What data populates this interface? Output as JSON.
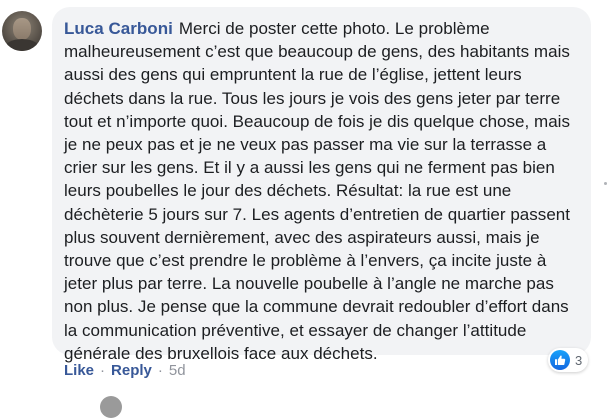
{
  "comment": {
    "author": "Luca Carboni",
    "text": "Merci de poster cette photo. Le problème malheureusement c’est que beaucoup de gens, des habitants mais aussi des gens qui empruntent la rue de l’église, jettent leurs déchets dans la rue. Tous les jours je vois des gens jeter par terre tout et n’importe quoi. Beaucoup de fois je dis quelque chose, mais je ne peux pas et je ne veux pas passer ma vie sur la terrasse a crier sur les gens. Et il y a aussi les gens qui ne ferment pas bien leurs poubelles le jour des déchets. Résultat: la rue est une déchèterie 5 jours sur 7. Les agents d’entretien de quartier passent plus souvent dernièrement, avec des aspirateurs aussi, mais je trouve que c’est prendre le problème à l’envers, ça incite juste à jeter plus par terre. La nouvelle poubelle à l’angle ne marche pas non plus. Je pense que la commune devrait redoubler d’effort dans la communication préventive, et essayer de changer l’attitude générale des bruxellois face aux déchets.",
    "reactions": {
      "icon": "like-icon",
      "count": "3"
    },
    "actions": {
      "like_label": "Like",
      "reply_label": "Reply",
      "separator": "·",
      "timestamp": "5d"
    }
  },
  "colors": {
    "author_link": "#385898",
    "bubble_bg": "#f2f3f5",
    "text": "#1c1e21",
    "meta": "#90949c",
    "like_blue": "#1877f2"
  }
}
